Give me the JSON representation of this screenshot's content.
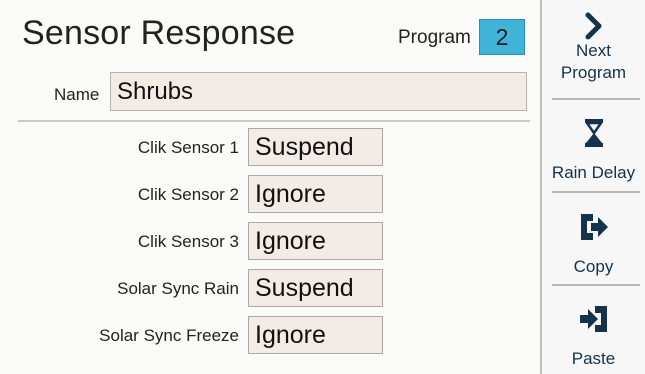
{
  "header": {
    "title": "Sensor Response",
    "program_label": "Program",
    "program_value": "2"
  },
  "name_field": {
    "label": "Name",
    "value": "Shrubs"
  },
  "sensors": [
    {
      "label": "Clik Sensor 1",
      "value": "Suspend"
    },
    {
      "label": "Clik Sensor 2",
      "value": "Ignore"
    },
    {
      "label": "Clik Sensor 3",
      "value": "Ignore"
    },
    {
      "label": "Solar Sync Rain",
      "value": "Suspend"
    },
    {
      "label": "Solar Sync Freeze",
      "value": "Ignore"
    }
  ],
  "sidebar": {
    "next": {
      "line1": "Next",
      "line2": "Program",
      "icon": "chevron-right-icon"
    },
    "rain_delay": {
      "label": "Rain Delay",
      "icon": "hourglass-icon"
    },
    "copy": {
      "label": "Copy",
      "icon": "copy-arrow-icon"
    },
    "paste": {
      "label": "Paste",
      "icon": "paste-arrow-icon"
    }
  },
  "colors": {
    "program_box": "#3fb4d8",
    "field_bg": "#f3ebe6",
    "icon": "#14324a"
  }
}
